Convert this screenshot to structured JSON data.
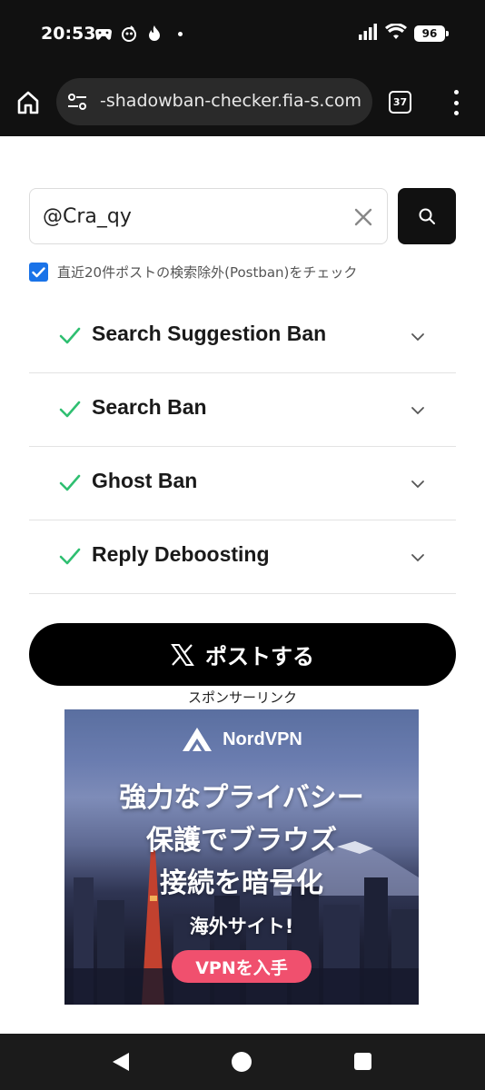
{
  "status_bar": {
    "time": "20:53",
    "left_icons": [
      "game-controller-icon",
      "app-notification-icon",
      "tinder-flame-icon"
    ],
    "battery": "96"
  },
  "browser": {
    "url": "-shadowban-checker.fia-s.com",
    "tab_count": "37"
  },
  "search": {
    "value": "@Cra_qy"
  },
  "options": {
    "postban_label": "直近20件ポストの検索除外(Postban)をチェック",
    "postban_checked": true
  },
  "results": [
    {
      "label": "Search Suggestion Ban",
      "status": "ok"
    },
    {
      "label": "Search Ban",
      "status": "ok"
    },
    {
      "label": "Ghost Ban",
      "status": "ok"
    },
    {
      "label": "Reply Deboosting",
      "status": "ok"
    }
  ],
  "post_button": {
    "label": "ポストする"
  },
  "sponsor_label": "スポンサーリンク",
  "ad": {
    "brand": "NordVPN",
    "headline_lines": [
      "強力なプライバシー",
      "保護でブラウズ",
      "接続を暗号化"
    ],
    "sub": "海外サイト!",
    "cta": "VPNを入手"
  },
  "colors": {
    "accent_blue": "#1a73e8",
    "check_green": "#2fbf71",
    "cta_pink": "#f0506e"
  }
}
